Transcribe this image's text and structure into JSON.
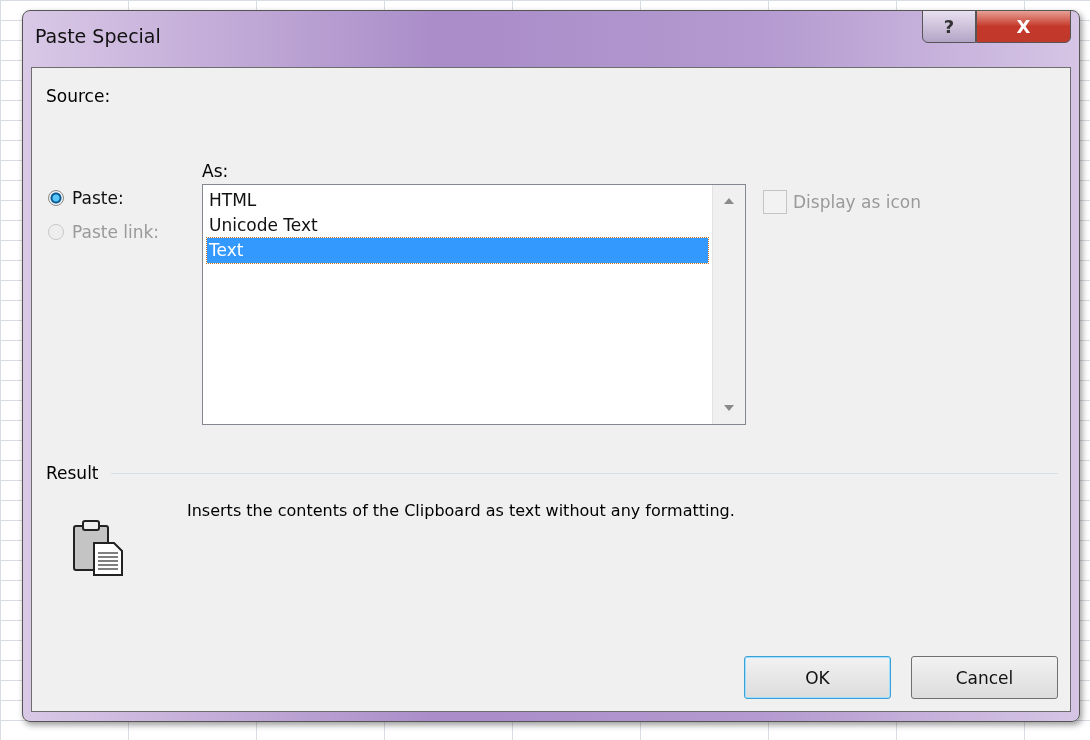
{
  "window": {
    "title": "Paste Special",
    "title_buttons": [
      {
        "kind": "help",
        "label": "?"
      },
      {
        "kind": "close",
        "label": "X"
      }
    ]
  },
  "source_label": "Source:",
  "as_label": "As:",
  "options": [
    {
      "label": "Paste:",
      "selected": true,
      "disabled": false
    },
    {
      "label": "Paste link:",
      "selected": false,
      "disabled": true
    }
  ],
  "formats": [
    {
      "label": "HTML",
      "selected": false
    },
    {
      "label": "Unicode Text",
      "selected": false
    },
    {
      "label": "Text",
      "selected": true
    }
  ],
  "display_as_icon": {
    "label": "Display as icon",
    "checked": false,
    "disabled": true
  },
  "result": {
    "label": "Result",
    "description": "Inserts the contents of the Clipboard as text without any formatting."
  },
  "buttons": [
    {
      "label": "OK",
      "default": true
    },
    {
      "label": "Cancel",
      "default": false
    }
  ]
}
